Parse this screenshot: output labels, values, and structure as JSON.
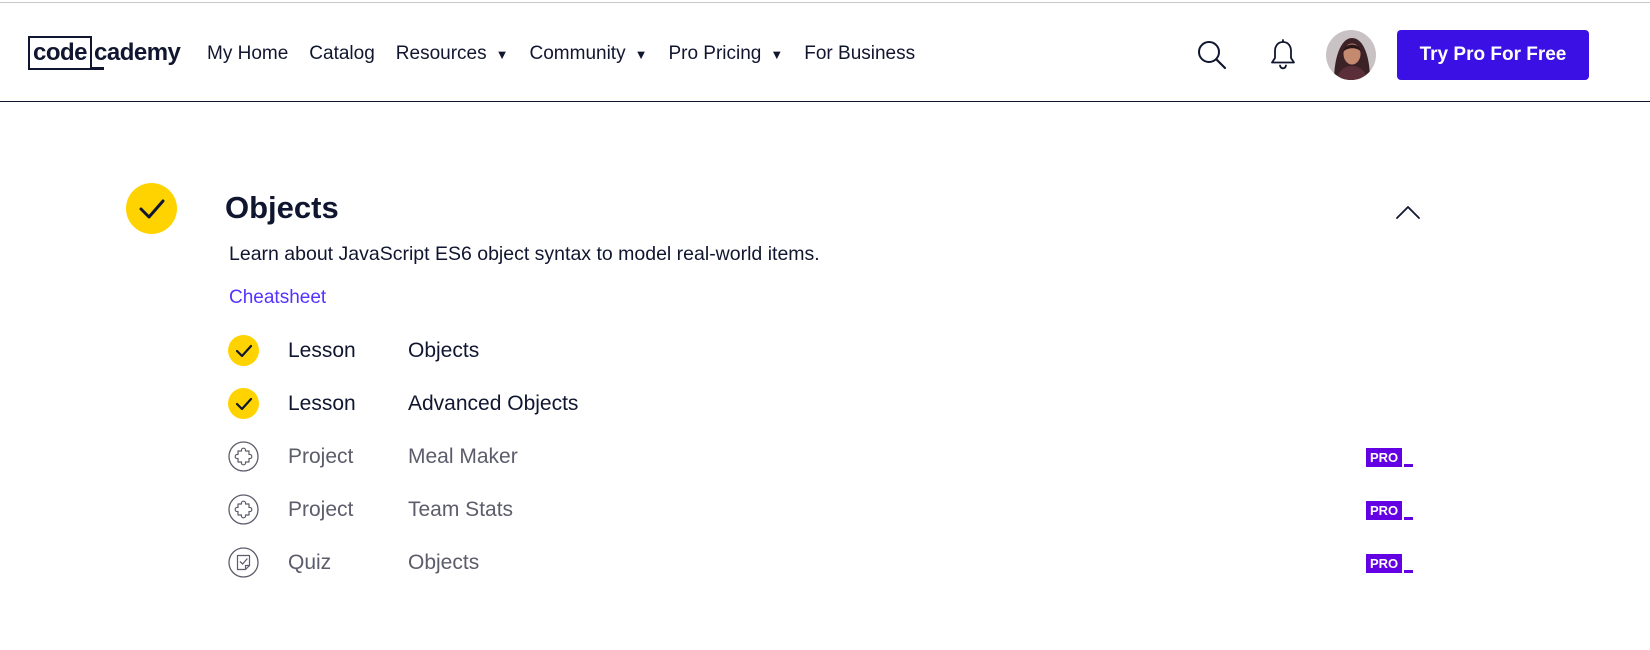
{
  "header": {
    "logo": {
      "boxed": "code",
      "rest": "cademy"
    },
    "nav": [
      {
        "label": "My Home",
        "has_dropdown": false
      },
      {
        "label": "Catalog",
        "has_dropdown": false
      },
      {
        "label": "Resources",
        "has_dropdown": true
      },
      {
        "label": "Community",
        "has_dropdown": true
      },
      {
        "label": "Pro Pricing",
        "has_dropdown": true
      },
      {
        "label": "For Business",
        "has_dropdown": false
      }
    ],
    "icons": {
      "search": "search-icon",
      "notifications": "bell-icon",
      "avatar": "user-avatar"
    },
    "cta_label": "Try Pro For Free"
  },
  "module": {
    "title": "Objects",
    "completed": true,
    "expanded": true,
    "description": "Learn about JavaScript ES6 object syntax to model real-world items.",
    "cheatsheet_label": "Cheatsheet",
    "items": [
      {
        "type": "Lesson",
        "name": "Objects",
        "status": "completed",
        "pro": false
      },
      {
        "type": "Lesson",
        "name": "Advanced Objects",
        "status": "completed",
        "pro": false
      },
      {
        "type": "Project",
        "name": "Meal Maker",
        "status": "locked",
        "icon": "puzzle-icon",
        "pro": true
      },
      {
        "type": "Project",
        "name": "Team Stats",
        "status": "locked",
        "icon": "puzzle-icon",
        "pro": true
      },
      {
        "type": "Quiz",
        "name": "Objects",
        "status": "locked",
        "icon": "quiz-icon",
        "pro": true
      }
    ],
    "pro_badge_label": "PRO"
  },
  "colors": {
    "brand": "#3a10e5",
    "complete": "#ffd300",
    "pro": "#6400e4",
    "link": "#5533ff",
    "text": "#10162f"
  }
}
